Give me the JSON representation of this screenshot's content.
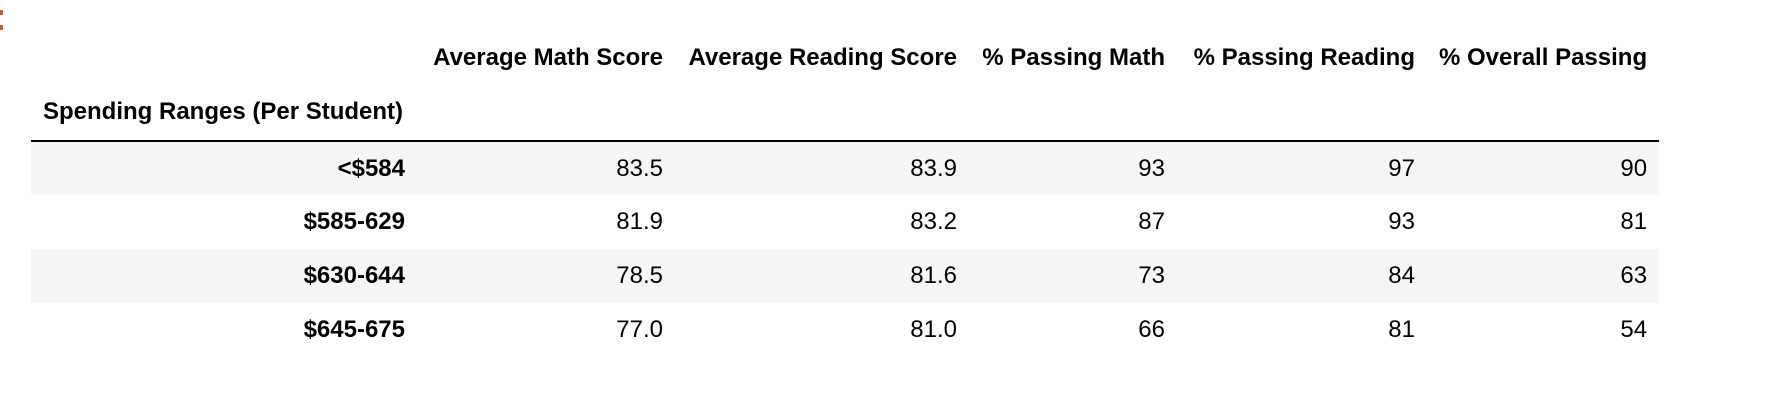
{
  "output_marker_color": "#e0531f",
  "table": {
    "index_name": "Spending Ranges (Per Student)",
    "columns": [
      "Average Math Score",
      "Average Reading Score",
      "% Passing Math",
      "% Passing Reading",
      "% Overall Passing"
    ],
    "rows": [
      {
        "index": "<$584",
        "values": [
          "83.5",
          "83.9",
          "93",
          "97",
          "90"
        ]
      },
      {
        "index": "$585-629",
        "values": [
          "81.9",
          "83.2",
          "87",
          "93",
          "81"
        ]
      },
      {
        "index": "$630-644",
        "values": [
          "78.5",
          "81.6",
          "73",
          "84",
          "63"
        ]
      },
      {
        "index": "$645-675",
        "values": [
          "77.0",
          "81.0",
          "66",
          "81",
          "54"
        ]
      }
    ]
  }
}
